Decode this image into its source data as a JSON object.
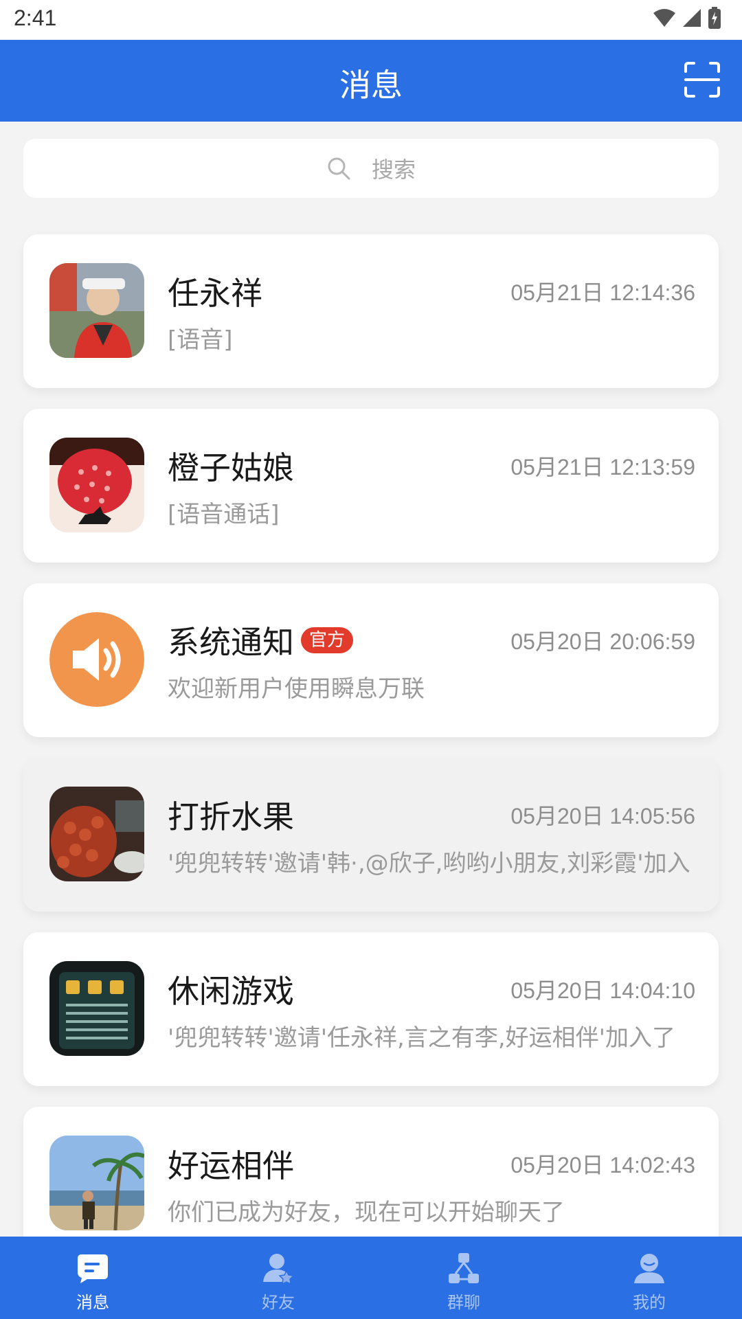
{
  "status_bar": {
    "time": "2:41",
    "icons": [
      "wifi-icon",
      "signal-icon",
      "battery-charging-icon"
    ]
  },
  "header": {
    "title": "消息",
    "scan_icon": "scan-icon"
  },
  "search": {
    "placeholder": "搜索",
    "icon": "search-icon"
  },
  "conversations": [
    {
      "name": "任永祥",
      "time": "05月21日 12:14:36",
      "preview": "[语音]",
      "avatar": "photo-man-cap"
    },
    {
      "name": "橙子姑娘",
      "time": "05月21日 12:13:59",
      "preview": "[语音通话]",
      "avatar": "photo-strawberry-rider"
    },
    {
      "name": "系统通知",
      "badge": "官方",
      "time": "05月20日 20:06:59",
      "preview": "欢迎新用户使用瞬息万联",
      "avatar": "speaker-icon"
    },
    {
      "name": "打折水果",
      "time": "05月20日 14:05:56",
      "preview": "'兜兜转转'邀请'韩·,@欣子,哟哟小朋友,刘彩霞'加入",
      "avatar": "photo-fruit"
    },
    {
      "name": "休闲游戏",
      "time": "05月20日 14:04:10",
      "preview": "'兜兜转转'邀请'任永祥,言之有李,好运相伴'加入了",
      "avatar": "photo-game-menu"
    },
    {
      "name": "好运相伴",
      "time": "05月20日 14:02:43",
      "preview": "你们已成为好友，现在可以开始聊天了",
      "avatar": "photo-beach-man"
    }
  ],
  "tabs": [
    {
      "label": "消息",
      "icon": "chat-icon",
      "active": true
    },
    {
      "label": "好友",
      "icon": "friend-icon",
      "active": false
    },
    {
      "label": "群聊",
      "icon": "group-icon",
      "active": false
    },
    {
      "label": "我的",
      "icon": "profile-icon",
      "active": false
    }
  ],
  "colors": {
    "primary": "#2a6fe4",
    "tab_active": "#ffffff",
    "tab_inactive": "#a9c4f2",
    "badge": "#e23b2b",
    "system_avatar": "#f0954b"
  }
}
